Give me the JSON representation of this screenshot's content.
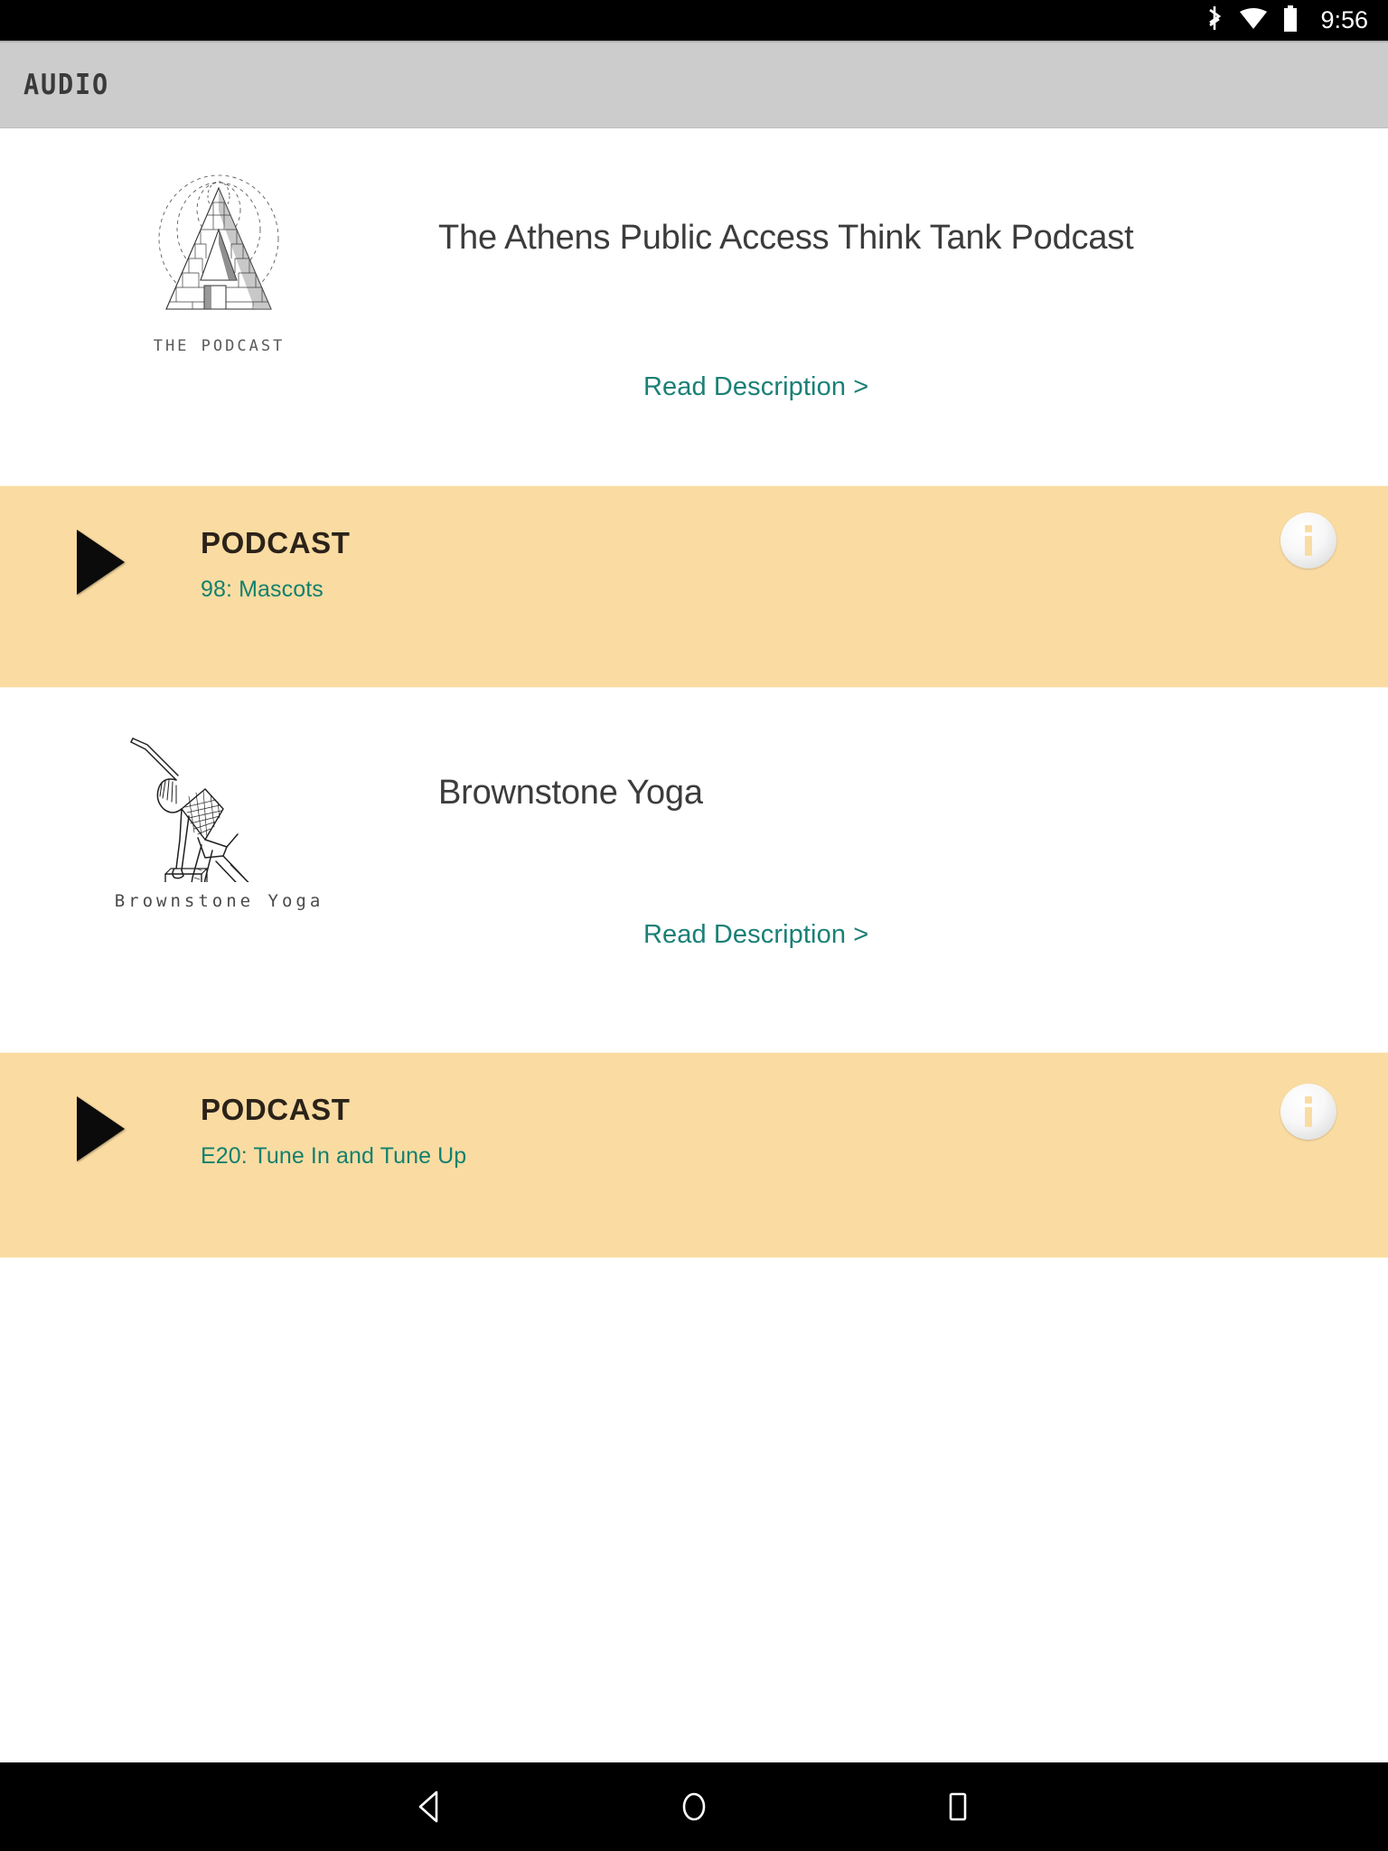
{
  "status_bar": {
    "time": "9:56",
    "icons": [
      "bluetooth-icon",
      "wifi-icon",
      "battery-icon"
    ]
  },
  "app_bar": {
    "title": "AUDIO"
  },
  "shows": [
    {
      "id": "athens-podcast",
      "logo_name": "athens-public-access-think-tank-logo",
      "logo_caption": "THE PODCAST",
      "title": "The Athens Public Access Think Tank Podcast",
      "read_description_label": "Read Description >",
      "episode_row": {
        "play_icon": "play-icon",
        "label": "PODCAST",
        "episode": "98: Mascots",
        "info_icon": "info-icon"
      }
    },
    {
      "id": "brownstone-yoga",
      "logo_name": "brownstone-yoga-logo",
      "logo_caption": "Brownstone Yoga",
      "title": "Brownstone Yoga",
      "read_description_label": "Read Description >",
      "episode_row": {
        "play_icon": "play-icon",
        "label": "PODCAST",
        "episode": "E20: Tune In and Tune Up",
        "info_icon": "info-icon"
      }
    }
  ],
  "nav_bar": {
    "back_label": "back-icon",
    "home_label": "home-icon",
    "recents_label": "recents-icon"
  },
  "colors": {
    "band_background": "#fadca2",
    "app_bar_background": "#cccccc",
    "link_teal": "#1a8076",
    "episode_teal": "#12806e",
    "status_bar": "#000000"
  }
}
